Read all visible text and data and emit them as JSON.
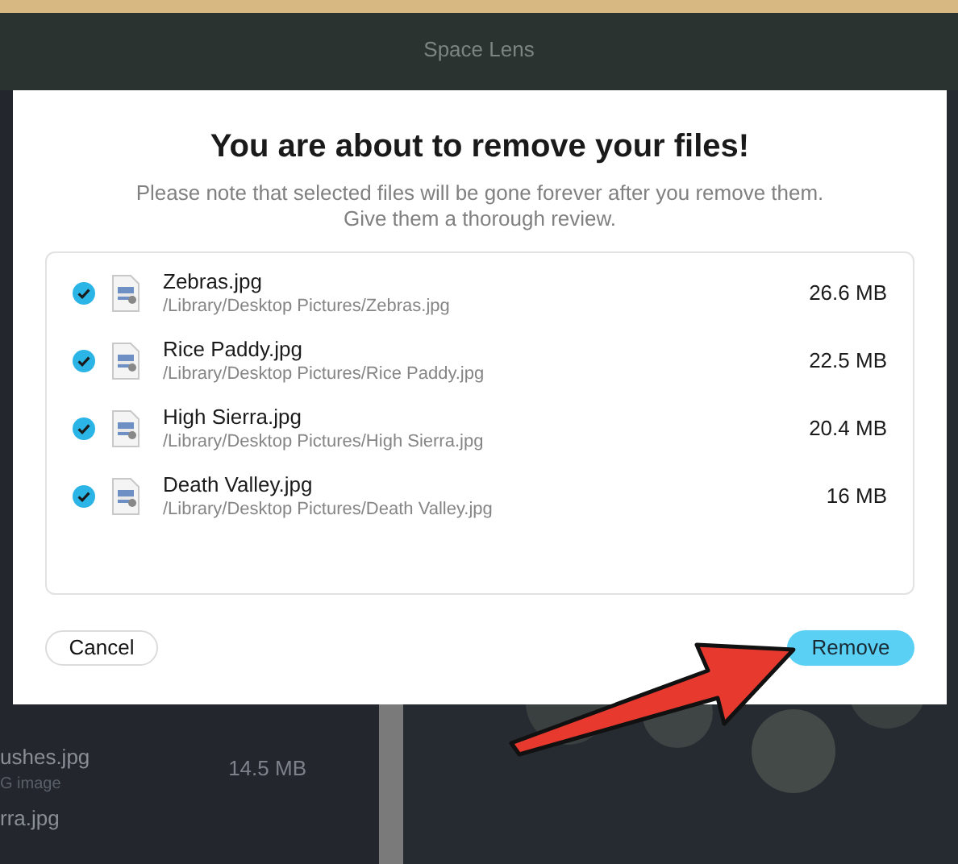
{
  "window": {
    "title": "Space Lens"
  },
  "background_list": [
    {
      "name": "ushes.jpg",
      "type": "G image",
      "size": "14.5 MB"
    },
    {
      "name": "rra.jpg"
    }
  ],
  "dialog": {
    "title": "You are about to remove your files!",
    "message": "Please note that selected files will be gone forever after you remove them. Give them a thorough review.",
    "files": [
      {
        "name": "Zebras.jpg",
        "path": "/Library/Desktop Pictures/Zebras.jpg",
        "size": "26.6 MB",
        "checked": true
      },
      {
        "name": "Rice Paddy.jpg",
        "path": "/Library/Desktop Pictures/Rice Paddy.jpg",
        "size": "22.5 MB",
        "checked": true
      },
      {
        "name": "High Sierra.jpg",
        "path": "/Library/Desktop Pictures/High Sierra.jpg",
        "size": "20.4 MB",
        "checked": true
      },
      {
        "name": "Death Valley.jpg",
        "path": "/Library/Desktop Pictures/Death Valley.jpg",
        "size": "16 MB",
        "checked": true
      }
    ],
    "buttons": [
      {
        "label": "Cancel",
        "kind": "secondary"
      },
      {
        "label": "Remove",
        "kind": "primary"
      }
    ]
  }
}
